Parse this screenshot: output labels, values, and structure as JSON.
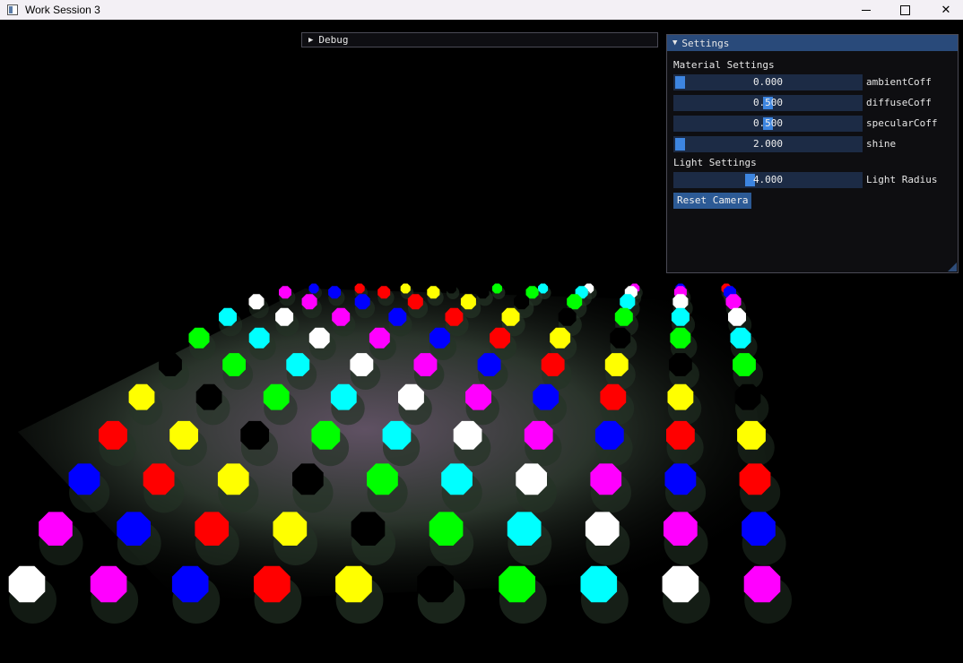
{
  "window": {
    "title": "Work Session 3"
  },
  "debug_panel": {
    "title": "Debug",
    "collapsed": true
  },
  "settings_panel": {
    "title": "Settings",
    "material_section": "Material Settings",
    "sliders": [
      {
        "label": "ambientCoff",
        "value": "0.000",
        "fraction": 0.0
      },
      {
        "label": "diffuseCoff",
        "value": "0.500",
        "fraction": 0.5
      },
      {
        "label": "specularCoff",
        "value": "0.500",
        "fraction": 0.5
      },
      {
        "label": "shine",
        "value": "2.000",
        "fraction": 0.0
      }
    ],
    "light_section": "Light Settings",
    "light_slider": {
      "label": "Light Radius",
      "value": "4.000",
      "fraction": 0.4
    },
    "reset_button": "Reset Camera"
  },
  "colors": {
    "panel_header": "#294a7a",
    "slider_bg": "#1c2b45",
    "slider_grab": "#3d85e0",
    "button": "#2c5a95"
  },
  "scene": {
    "light_colors": [
      "#0000ff",
      "#00ffff",
      "#ffff00",
      "#ff00ff",
      "#00ff00",
      "#ff0000",
      "#ffffff",
      "#000000"
    ]
  }
}
